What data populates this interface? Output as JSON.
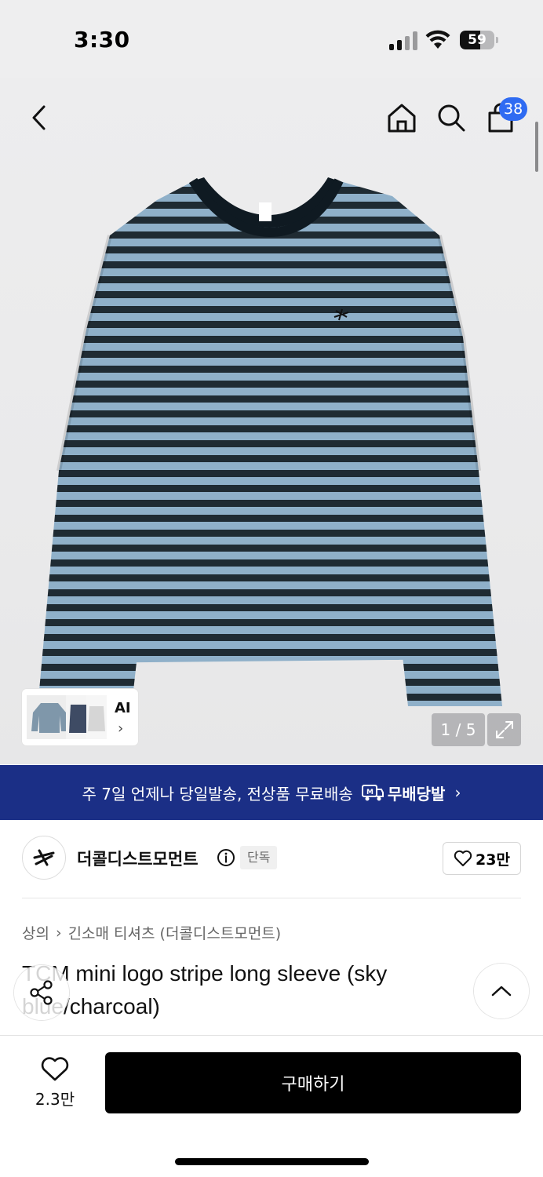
{
  "status_bar": {
    "time": "3:30",
    "battery": "59",
    "battery_level": 0.59
  },
  "nav": {
    "back": "back-icon",
    "home": "home-icon",
    "search": "search-icon",
    "cart": "bag-icon",
    "cart_badge": "38"
  },
  "gallery": {
    "ai_label": "AI",
    "ai_chevron": "›",
    "page_counter": "1 / 5",
    "expand": "expand-icon",
    "stripe_colors": {
      "light": "#8fb0c9",
      "dark": "#1f2b33"
    }
  },
  "promo": {
    "text": "주 7일 언제나 당일발송, 전상품 무료배송",
    "brand": "무배당발",
    "chevron": "›",
    "bg": "#1b2f86"
  },
  "brand": {
    "name": "더콜디스트모먼트",
    "badge": "단독",
    "likes": "23만"
  },
  "breadcrumb": {
    "category": "상의",
    "separator": "›",
    "subcategory": "긴소매 티셔츠 (더콜디스트모먼트)"
  },
  "product": {
    "title": "TCM mini logo stripe long sleeve (sky blue/charcoal)"
  },
  "bottom": {
    "wish_count": "2.3만",
    "buy_label": "구매하기"
  }
}
